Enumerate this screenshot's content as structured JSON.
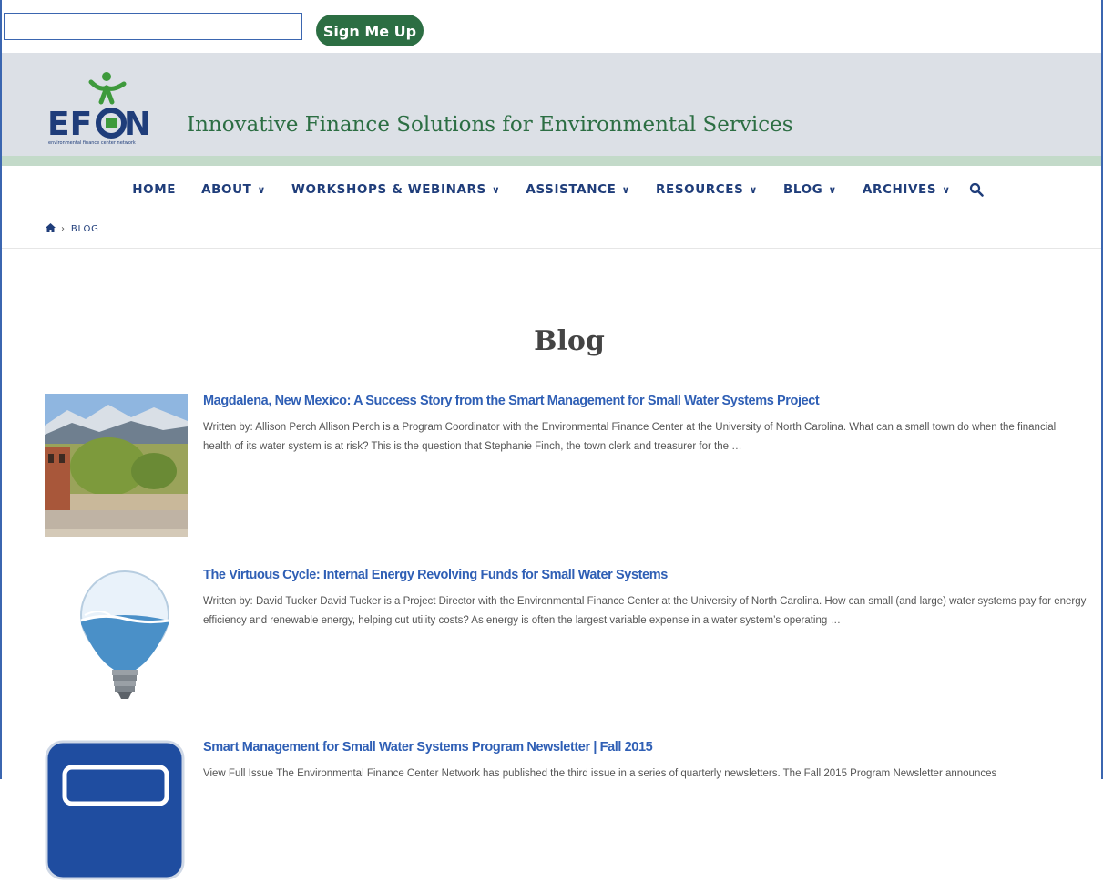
{
  "signup": {
    "input_value": "",
    "button_label": "Sign Me Up"
  },
  "header": {
    "logo_text": "EFCN",
    "logo_subtext": "environmental finance center network",
    "tagline": "Innovative Finance Solutions for Environmental Services"
  },
  "nav": {
    "items": [
      {
        "label": "HOME",
        "has_dropdown": false
      },
      {
        "label": "ABOUT",
        "has_dropdown": true
      },
      {
        "label": "WORKSHOPS & WEBINARS",
        "has_dropdown": true
      },
      {
        "label": "ASSISTANCE",
        "has_dropdown": true
      },
      {
        "label": "RESOURCES",
        "has_dropdown": true
      },
      {
        "label": "BLOG",
        "has_dropdown": true
      },
      {
        "label": "ARCHIVES",
        "has_dropdown": true
      }
    ],
    "dropdown_glyph": "»",
    "search_icon": "search-icon"
  },
  "breadcrumb": {
    "home_icon": "home-icon",
    "separator": "›",
    "current": "BLOG"
  },
  "page": {
    "title": "Blog"
  },
  "posts": [
    {
      "title": "Magdalena, New Mexico: A Success Story from the Smart Management for Small Water Systems Project",
      "excerpt": "Written by: Allison Perch Allison Perch is a Program Coordinator with the Environmental Finance Center at the University of North Carolina.  What can a small town do when the financial health of its water system is at risk? This is the question that Stephanie Finch, the town clerk and treasurer for the …"
    },
    {
      "title": "The Virtuous Cycle: Internal Energy Revolving Funds for Small Water Systems",
      "excerpt": "Written by: David Tucker David Tucker is a Project Director with the Environmental Finance Center at the University of North Carolina.  How can small (and large) water systems pay for energy efficiency and renewable energy, helping cut utility costs? As energy is often the largest variable expense in a water system’s operating …"
    },
    {
      "title": "Smart Management for Small Water Systems Program Newsletter | Fall 2015",
      "excerpt": "View Full Issue The Environmental Finance Center Network has published the third issue in a series of quarterly newsletters. The Fall 2015 Program Newsletter announces"
    }
  ],
  "colors": {
    "brand_green": "#2c6e43",
    "nav_blue": "#1f3d7a",
    "link_blue": "#2f5fb5",
    "header_bg": "#dce0e6",
    "header_stripe": "#c3dac9"
  }
}
